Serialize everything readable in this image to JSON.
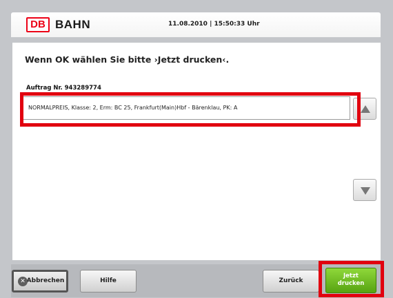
{
  "header": {
    "logo_text": "DB",
    "brand": "BAHN",
    "datetime": "11.08.2010 | 15:50:33 Uhr"
  },
  "main": {
    "instruction": "Wenn OK wählen Sie bitte ›Jetzt drucken‹.",
    "order_label": "Auftrag Nr. 943289774",
    "order_item": "NORMALPREIS, Klasse: 2, Erm: BC 25, Frankfurt(Main)Hbf - Bärenklau, PK: A"
  },
  "footer": {
    "cancel_label": "Abbrechen",
    "help_label": "Hilfe",
    "back_label": "Zurück",
    "print_label_line1": "Jetzt",
    "print_label_line2": "drucken"
  },
  "icons": {
    "cancel": "close-icon",
    "scroll_up": "triangle-up-icon",
    "scroll_down": "triangle-down-icon"
  },
  "colors": {
    "db_red": "#ec0016",
    "highlight_red": "#e1000f",
    "print_green": "#6fbf22"
  }
}
